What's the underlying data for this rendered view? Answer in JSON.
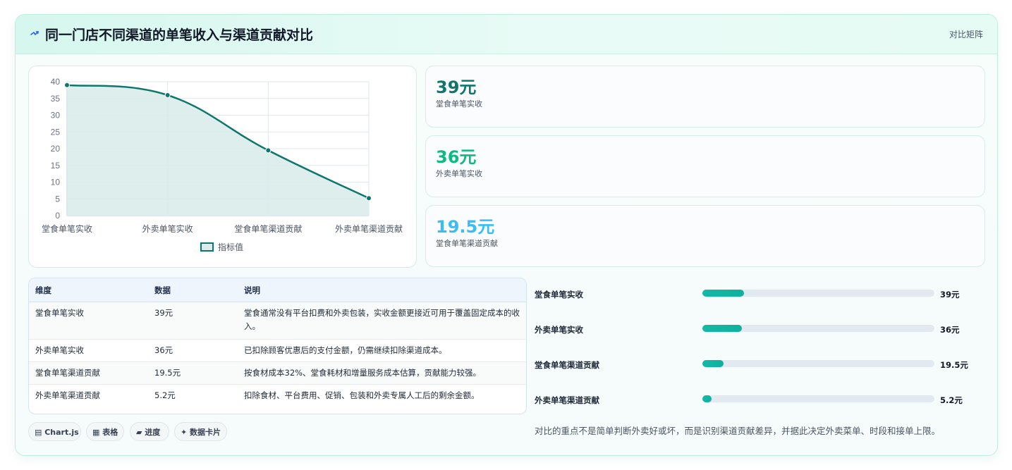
{
  "header": {
    "title": "同一门店不同渠道的单笔收入与渠道贡献对比",
    "right_label": "对比矩阵",
    "icon": "lightning-icon"
  },
  "chart_data": {
    "type": "line",
    "categories": [
      "堂食单笔实收",
      "外卖单笔实收",
      "堂食单笔渠道贡献",
      "外卖单笔渠道贡献"
    ],
    "series": [
      {
        "name": "指标值",
        "values": [
          39,
          36,
          19.5,
          5.2
        ]
      }
    ],
    "ylim": [
      0,
      40
    ],
    "yticks": [
      0,
      5,
      10,
      15,
      20,
      25,
      30,
      35,
      40
    ],
    "area_fill": true,
    "grid": true,
    "legend": "bottom",
    "colors": {
      "line": "#0f766e",
      "fill": "#d9ecea",
      "grid": "#dfe7f0"
    }
  },
  "stats": [
    {
      "value": "39元",
      "label": "堂食单笔实收",
      "color": "#0f766e"
    },
    {
      "value": "36元",
      "label": "外卖单笔实收",
      "color": "#10b981"
    },
    {
      "value": "19.5元",
      "label": "堂食单笔渠道贡献",
      "color": "#38bdf8"
    }
  ],
  "table": {
    "headers": [
      "维度",
      "数据",
      "说明"
    ],
    "rows": [
      [
        "堂食单笔实收",
        "39元",
        "堂食通常没有平台扣费和外卖包装，实收金额更接近可用于覆盖固定成本的收入。"
      ],
      [
        "外卖单笔实收",
        "36元",
        "已扣除顾客优惠后的支付金额，仍需继续扣除渠道成本。"
      ],
      [
        "堂食单笔渠道贡献",
        "19.5元",
        "按食材成本32%、堂食耗材和增量服务成本估算，贡献能力较强。"
      ],
      [
        "外卖单笔渠道贡献",
        "5.2元",
        "扣除食材、平台费用、促销、包装和外卖专属人工后的剩余金额。"
      ]
    ]
  },
  "tags": [
    "▤ Chart.js",
    "▦ 表格",
    "▰ 进度",
    "✦ 数据卡片"
  ],
  "progress": [
    {
      "label": "堂食单笔实收",
      "value": "39元",
      "fraction": 0.18
    },
    {
      "label": "外卖单笔实收",
      "value": "36元",
      "fraction": 0.17
    },
    {
      "label": "堂食单笔渠道贡献",
      "value": "19.5元",
      "fraction": 0.09
    },
    {
      "label": "外卖单笔渠道贡献",
      "value": "5.2元",
      "fraction": 0.04
    }
  ],
  "note": "对比的重点不是简单判断外卖好或坏，而是识别渠道贡献差异，并据此决定外卖菜单、时段和接单上限。"
}
